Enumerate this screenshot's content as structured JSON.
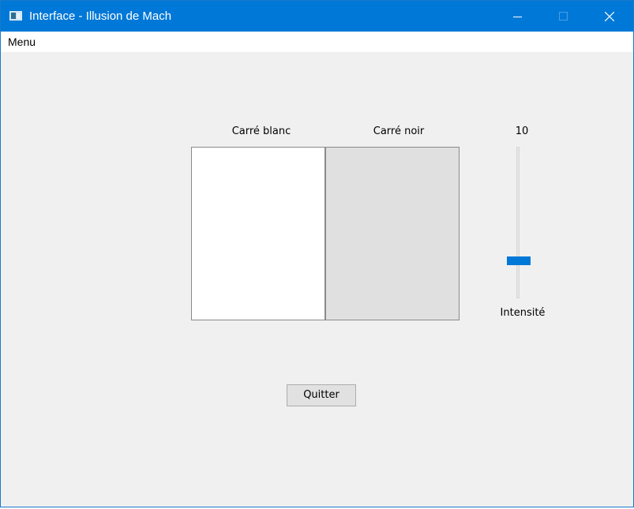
{
  "window": {
    "title": "Interface - Illusion de Mach",
    "icon": "app-window-icon",
    "accent": "#0078d7",
    "controls": [
      "minimize-icon",
      "maximize-icon",
      "close-icon"
    ]
  },
  "menubar": {
    "items": [
      {
        "label": "Menu"
      }
    ]
  },
  "main": {
    "white_square": {
      "label": "Carré blanc",
      "color": "#ffffff"
    },
    "black_square": {
      "label": "Carré noir",
      "color": "#e0e0e0"
    },
    "slider": {
      "value_label": "10",
      "label": "Intensité",
      "level_fraction": 0.23
    },
    "quit_button": {
      "label": "Quitter"
    }
  }
}
